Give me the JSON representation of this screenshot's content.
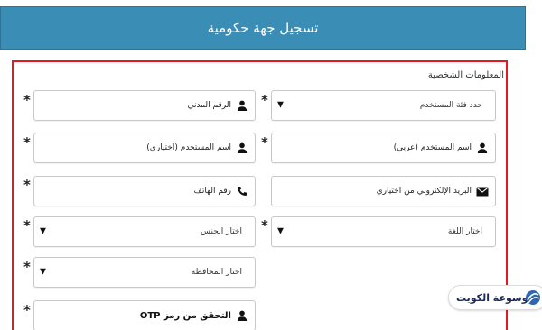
{
  "header": {
    "title": "تسجيل جهة حكومية"
  },
  "section": {
    "label": "المعلومات الشخصية"
  },
  "fields": {
    "user_category": {
      "text": "حدد فئة المستخدم",
      "icon": "chevron-down-icon"
    },
    "civil_id": {
      "text": "الرقم المدني",
      "icon": "user-icon"
    },
    "username_ar": {
      "text": "اسم المستخدم (عربي)",
      "icon": "user-icon"
    },
    "username_optional": {
      "text": "اسم المستخدم (اختياري)",
      "icon": "user-icon"
    },
    "email": {
      "text": "البريد الإلكتروني من اختياري",
      "icon": "envelope-icon"
    },
    "phone": {
      "text": "رقم الهاتف",
      "icon": "phone-icon"
    },
    "language": {
      "text": "اختار اللغة",
      "icon": "chevron-down-icon"
    },
    "gender": {
      "text": "اختار الجنس",
      "icon": "chevron-down-icon"
    },
    "governorate": {
      "text": "اختار المحافظة",
      "icon": "chevron-down-icon"
    },
    "otp": {
      "text": "التحقق من رمز OTP",
      "icon": "user-icon"
    }
  },
  "required_marker": "*",
  "watermark": {
    "text": "موسوعة الكويت",
    "icon": "globe-logo-icon"
  },
  "colors": {
    "header": "#3a8eb6",
    "frame": "#e21a22"
  }
}
